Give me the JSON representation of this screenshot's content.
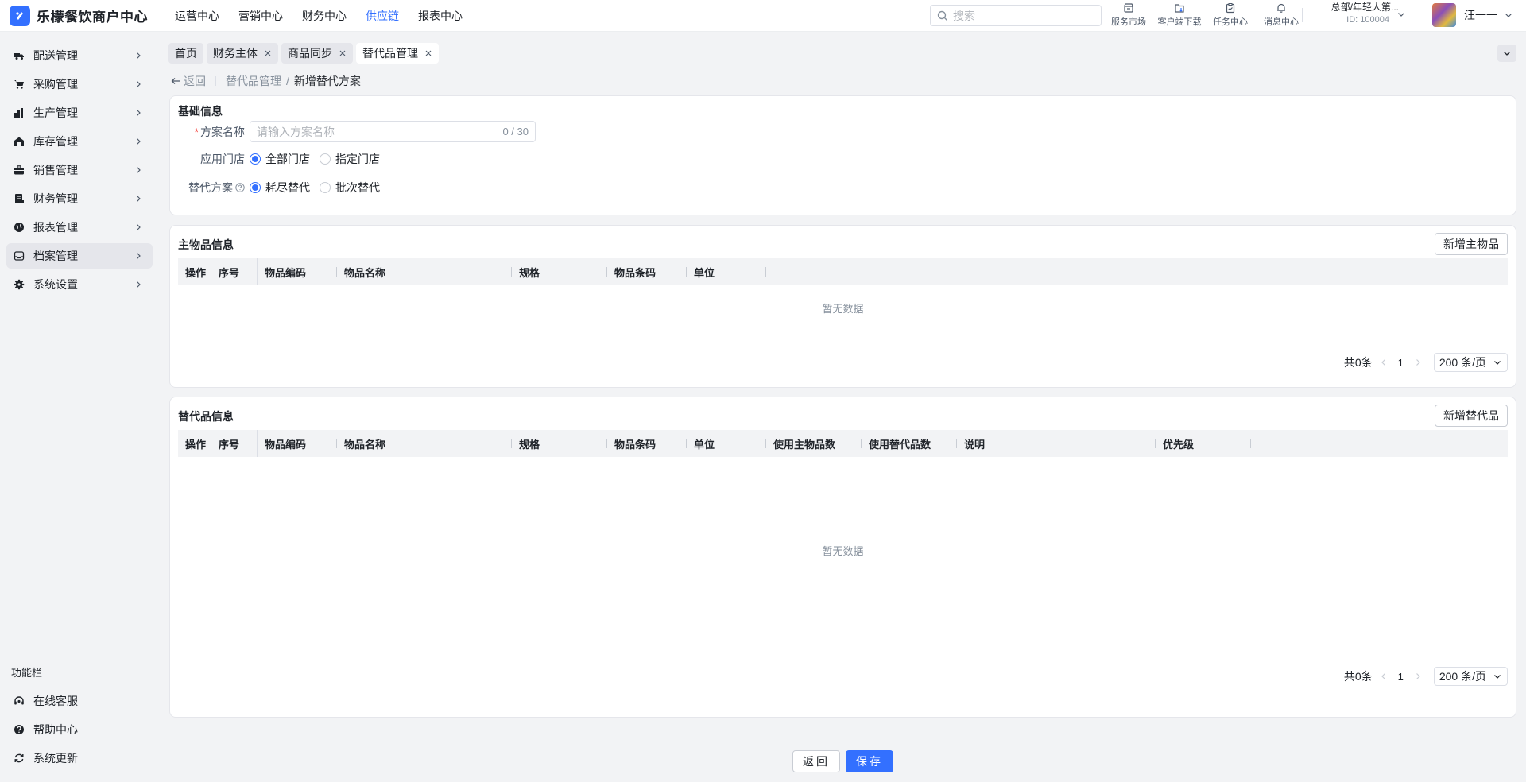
{
  "app": {
    "title": "乐檬餐饮商户中心",
    "brand_color": "#3370ff"
  },
  "topnav": [
    {
      "label": "运营中心",
      "active": false
    },
    {
      "label": "营销中心",
      "active": false
    },
    {
      "label": "财务中心",
      "active": false
    },
    {
      "label": "供应链",
      "active": true
    },
    {
      "label": "报表中心",
      "active": false
    }
  ],
  "search": {
    "placeholder": "搜索",
    "icon": "search-icon"
  },
  "tools": [
    {
      "label": "服务市场",
      "icon": "store-icon"
    },
    {
      "label": "客户端下载",
      "icon": "download-icon"
    },
    {
      "label": "任务中心",
      "icon": "clipboard-icon"
    },
    {
      "label": "消息中心",
      "icon": "bell-icon"
    }
  ],
  "org": {
    "name": "总部/年轻人第...",
    "id": "ID: 100004"
  },
  "user": {
    "name": "汪一一"
  },
  "sidebar": {
    "items": [
      {
        "label": "配送管理",
        "icon": "truck-icon"
      },
      {
        "label": "采购管理",
        "icon": "cart-icon"
      },
      {
        "label": "生产管理",
        "icon": "factory-icon"
      },
      {
        "label": "库存管理",
        "icon": "warehouse-icon"
      },
      {
        "label": "销售管理",
        "icon": "briefcase-icon"
      },
      {
        "label": "财务管理",
        "icon": "ledger-icon"
      },
      {
        "label": "报表管理",
        "icon": "globe-icon"
      },
      {
        "label": "档案管理",
        "icon": "archive-icon",
        "active": true
      },
      {
        "label": "系统设置",
        "icon": "gear-icon"
      }
    ],
    "section_title": "功能栏",
    "bottom": [
      {
        "label": "在线客服",
        "icon": "headset-icon"
      },
      {
        "label": "帮助中心",
        "icon": "help-icon"
      },
      {
        "label": "系统更新",
        "icon": "refresh-icon"
      }
    ]
  },
  "tabs": [
    {
      "label": "首页",
      "closable": false,
      "active": false
    },
    {
      "label": "财务主体",
      "closable": true,
      "active": false
    },
    {
      "label": "商品同步",
      "closable": true,
      "active": false
    },
    {
      "label": "替代品管理",
      "closable": true,
      "active": true
    }
  ],
  "breadcrumb": {
    "back": "返回",
    "parent": "替代品管理",
    "separator": "/",
    "current": "新增替代方案"
  },
  "basic": {
    "title": "基础信息",
    "name_label": "方案名称",
    "name_required": "*",
    "name_placeholder": "请输入方案名称",
    "name_count": "0 / 30",
    "store_label": "应用门店",
    "store_options": [
      {
        "label": "全部门店",
        "checked": true
      },
      {
        "label": "指定门店",
        "checked": false
      }
    ],
    "plan_label": "替代方案",
    "plan_options": [
      {
        "label": "耗尽替代",
        "checked": true
      },
      {
        "label": "批次替代",
        "checked": false
      }
    ]
  },
  "main_items": {
    "title": "主物品信息",
    "add_button": "新增主物品",
    "columns": [
      "操作",
      "序号",
      "物品编码",
      "物品名称",
      "规格",
      "物品条码",
      "单位"
    ],
    "empty": "暂无数据",
    "pager": {
      "total": "共0条",
      "page": "1",
      "size": "200 条/页"
    }
  },
  "sub_items": {
    "title": "替代品信息",
    "add_button": "新增替代品",
    "columns": [
      "操作",
      "序号",
      "物品编码",
      "物品名称",
      "规格",
      "物品条码",
      "单位",
      "使用主物品数",
      "使用替代品数",
      "说明",
      "优先级"
    ],
    "empty": "暂无数据",
    "pager": {
      "total": "共0条",
      "page": "1",
      "size": "200 条/页"
    }
  },
  "footer": {
    "back": "返回",
    "save": "保存"
  }
}
